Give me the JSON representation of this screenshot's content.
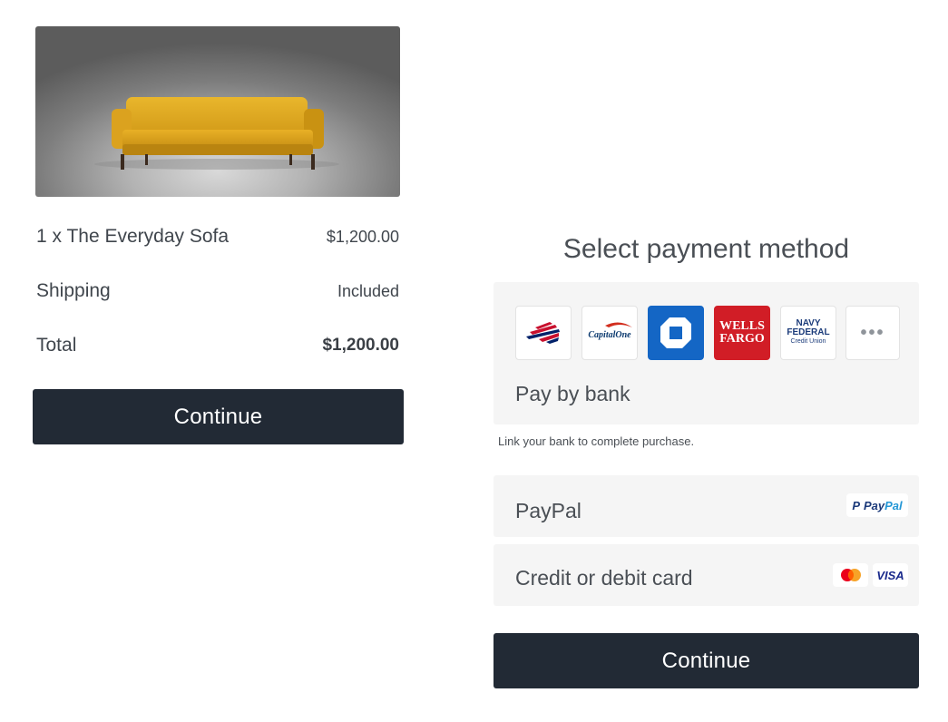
{
  "order": {
    "item_label": "1 x The Everyday Sofa",
    "item_price": "$1,200.00",
    "shipping_label": "Shipping",
    "shipping_value": "Included",
    "total_label": "Total",
    "total_value": "$1,200.00",
    "continue_label": "Continue"
  },
  "payment": {
    "title": "Select payment method",
    "bank": {
      "label": "Pay by bank",
      "hint": "Link your bank to complete purchase.",
      "banks": [
        {
          "name": "bank-of-america",
          "icon": "bank-of-america-flag-icon"
        },
        {
          "name": "capital-one",
          "logo_text": "CapitalOne"
        },
        {
          "name": "chase",
          "icon": "chase-octagon-icon"
        },
        {
          "name": "wells-fargo",
          "logo_line1": "WELLS",
          "logo_line2": "FARGO"
        },
        {
          "name": "navy-federal",
          "logo_line1": "NAVY",
          "logo_line2": "FEDERAL",
          "logo_line3": "Credit Union"
        },
        {
          "name": "more-banks",
          "icon": "more-dots-icon"
        }
      ]
    },
    "paypal": {
      "label": "PayPal",
      "badge_a": "Pay",
      "badge_b": "Pal"
    },
    "card": {
      "label": "Credit or debit card",
      "visa": "VISA"
    },
    "continue_label": "Continue"
  },
  "colors": {
    "button_bg": "#222a35",
    "card_bg": "#f5f5f5",
    "sofa": "#e0a620",
    "chase_blue": "#1466c5",
    "wells_red": "#d11d26"
  }
}
